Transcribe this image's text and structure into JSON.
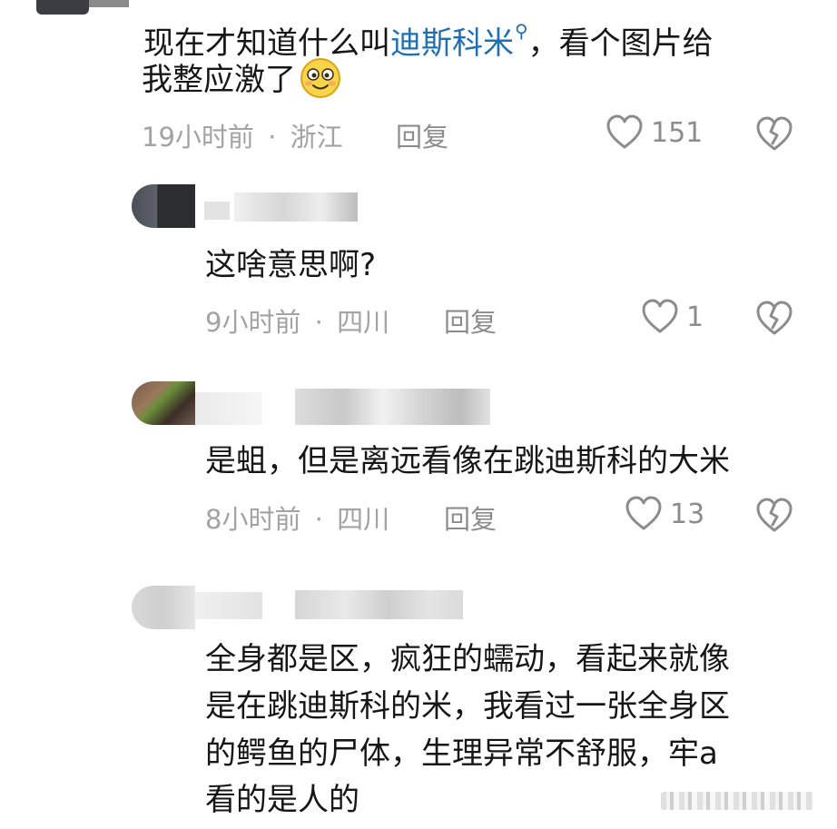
{
  "comments": [
    {
      "text_before": "现在才知道什么叫",
      "keyword": "迪斯科米",
      "text_after": "，看个图片给",
      "text_line2": "我整应激了",
      "time": "19小时前",
      "location": "浙江",
      "reply_label": "回复",
      "likes": "151",
      "emoji_icon": "smiling-face-emoji"
    },
    {
      "text": "这啥意思啊?",
      "time": "9小时前",
      "location": "四川",
      "reply_label": "回复",
      "likes": "1"
    },
    {
      "text": "是蛆，但是离远看像在跳迪斯科的大米",
      "time": "8小时前",
      "location": "四川",
      "reply_label": "回复",
      "likes": "13"
    },
    {
      "lines": [
        "全身都是区，疯狂的蠕动，看起来就像",
        "是在跳迪斯科的米，我看过一张全身区",
        "的鳄鱼的尸体，生理异常不舒服，牢a",
        "看的是人的"
      ]
    }
  ],
  "separator": "·",
  "colors": {
    "text": "#161616",
    "meta": "#a3a3a3",
    "keyword": "#1f6fb2",
    "icon": "#8c8c8c"
  }
}
